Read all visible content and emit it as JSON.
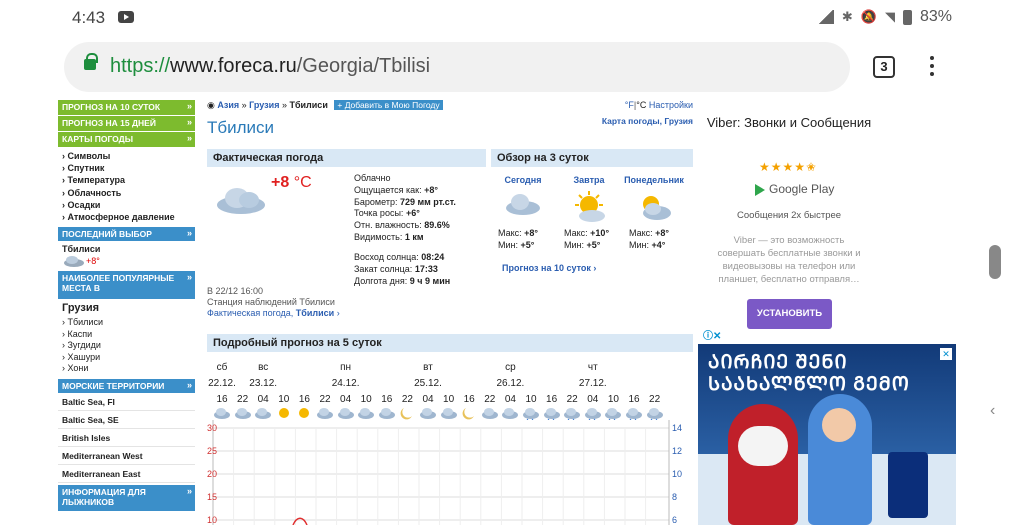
{
  "status": {
    "time": "4:43",
    "battery": "83%"
  },
  "browser": {
    "url_scheme": "https://",
    "url_host": "www.foreca.ru",
    "url_path": "/Georgia/Tbilisi",
    "tab_count": "3"
  },
  "sidebar": {
    "green_links": [
      "ПРОГНОЗ НА 10 СУТОК",
      "ПРОГНОЗ НА 15 ДНЕЙ",
      "КАРТЫ ПОГОДЫ"
    ],
    "map_items": [
      "Символы",
      "Спутник",
      "Температура",
      "Облачность",
      "Осадки",
      "Атмосферное давление"
    ],
    "last_choice_header": "ПОСЛЕДНИЙ ВЫБОР",
    "last_city": "Тбилиси",
    "last_temp": "+8°",
    "popular_header": "НАИБОЛЕЕ ПОПУЛЯРНЫЕ МЕСТА В",
    "country": "Грузия",
    "popular_cities": [
      "Тбилиси",
      "Каспи",
      "Зугдиди",
      "Хашури",
      "Хони"
    ],
    "sea_header": "МОРСКИЕ ТЕРРИТОРИИ",
    "seas": [
      "Baltic Sea, FI",
      "Baltic Sea, SE",
      "British Isles",
      "Mediterranean West",
      "Mediterranean East"
    ],
    "ski_header": "ИНФОРМАЦИЯ ДЛЯ ЛЫЖНИКОВ"
  },
  "crumb": {
    "region": "Азия",
    "country": "Грузия",
    "city": "Тбилиси",
    "add": "+ Добавить в Мою Погоду"
  },
  "units": {
    "f": "°F",
    "sep": "|",
    "c": "°C",
    "settings": "Настройки"
  },
  "page_title": "Тбилиси",
  "map_link": "Карта погоды, Грузия",
  "current": {
    "header": "Фактическая погода",
    "temp": "+8",
    "unit": "°C",
    "condition": "Облачно",
    "feels_label": "Ощущается как:",
    "feels": "+8°",
    "pressure_label": "Барометр:",
    "pressure": "729 мм рт.ст.",
    "dew_label": "Точка росы:",
    "dew": "+6°",
    "humidity_label": "Отн. влажность:",
    "humidity": "89.6%",
    "visibility_label": "Видимость:",
    "visibility": "1 км",
    "sunrise_label": "Восход солнца:",
    "sunrise": "08:24",
    "sunset_label": "Закат солнца:",
    "sunset": "17:33",
    "daylen_label": "Долгота дня:",
    "daylen": "9 ч 9 мин",
    "obs_time": "В 22/12 16:00",
    "station": "Станция наблюдений Тбилиси",
    "link_prefix": "Фактическая погода,",
    "link_city": "Тбилиси"
  },
  "overview": {
    "header": "Обзор на 3 суток",
    "days": [
      {
        "name": "Сегодня",
        "max_label": "Макс:",
        "max": "+8°",
        "min_label": "Мин:",
        "min": "+5°",
        "icon": "cloud-icon"
      },
      {
        "name": "Завтра",
        "max_label": "Макс:",
        "max": "+10°",
        "min_label": "Мин:",
        "min": "+5°",
        "icon": "sun-cloud-icon"
      },
      {
        "name": "Понедельник",
        "max_label": "Макс:",
        "max": "+8°",
        "min_label": "Мин:",
        "min": "+4°",
        "icon": "sun-cloud-icon"
      }
    ],
    "link": "Прогноз на 10 суток"
  },
  "forecast5": {
    "header": "Подробный прогноз на 5 суток",
    "days": [
      {
        "wd": "сб",
        "date": "22.12."
      },
      {
        "wd": "вс",
        "date": "23.12."
      },
      {
        "wd": "пн",
        "date": "24.12."
      },
      {
        "wd": "вт",
        "date": "25.12."
      },
      {
        "wd": "ср",
        "date": "26.12."
      },
      {
        "wd": "чт",
        "date": "27.12."
      }
    ],
    "hours": [
      "16",
      "22",
      "04",
      "10",
      "16",
      "22",
      "04",
      "10",
      "16",
      "22",
      "04",
      "10",
      "16",
      "22",
      "04",
      "10",
      "16",
      "22",
      "04",
      "10",
      "16",
      "22"
    ],
    "left_axis": [
      "30",
      "25",
      "20",
      "15",
      "10"
    ],
    "right_axis": [
      "14",
      "12",
      "10",
      "8",
      "6"
    ]
  },
  "ad": {
    "title": "Viber: Звонки и Сообщения",
    "stars": "★★★★✬",
    "store": "Google Play",
    "sub": "Сообщения 2х быстрее",
    "desc": "Viber — это возможность совершать бесплатные звонки и видеовызовы на телефон или планшет, бесплатно отправля…",
    "install": "УСТАНОВИТЬ",
    "banner_text": "ᲐᲘᲠᲩᲘᲔ ᲨᲔᲜᲘ ᲡᲐᲐᲮᲐᲚᲬᲚᲝ ᲒᲔᲛᲝ"
  }
}
